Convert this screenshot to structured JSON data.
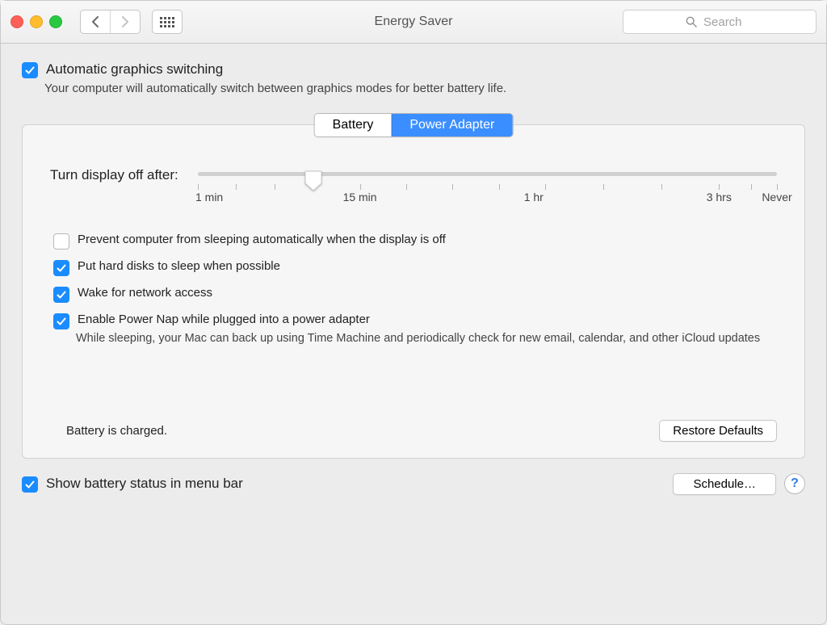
{
  "window": {
    "title": "Energy Saver",
    "search_placeholder": "Search"
  },
  "graphics": {
    "label": "Automatic graphics switching",
    "checked": true,
    "description": "Your computer will automatically switch between graphics modes for better battery life."
  },
  "tabs": {
    "battery": "Battery",
    "power_adapter": "Power Adapter",
    "active": "power_adapter"
  },
  "slider": {
    "label": "Turn display off after:",
    "value_percent": 20,
    "tick_labels": {
      "t1": "1 min",
      "t15": "15 min",
      "t60": "1 hr",
      "t180": "3 hrs",
      "never": "Never"
    }
  },
  "options": {
    "prevent_sleep": {
      "label": "Prevent computer from sleeping automatically when the display is off",
      "checked": false
    },
    "hard_disks": {
      "label": "Put hard disks to sleep when possible",
      "checked": true
    },
    "wake_network": {
      "label": "Wake for network access",
      "checked": true
    },
    "power_nap": {
      "label": "Enable Power Nap while plugged into a power adapter",
      "checked": true,
      "description": "While sleeping, your Mac can back up using Time Machine and periodically check for new email, calendar, and other iCloud updates"
    }
  },
  "status": "Battery is charged.",
  "buttons": {
    "restore": "Restore Defaults",
    "schedule": "Schedule…"
  },
  "show_status": {
    "label": "Show battery status in menu bar",
    "checked": true
  },
  "help_label": "?"
}
